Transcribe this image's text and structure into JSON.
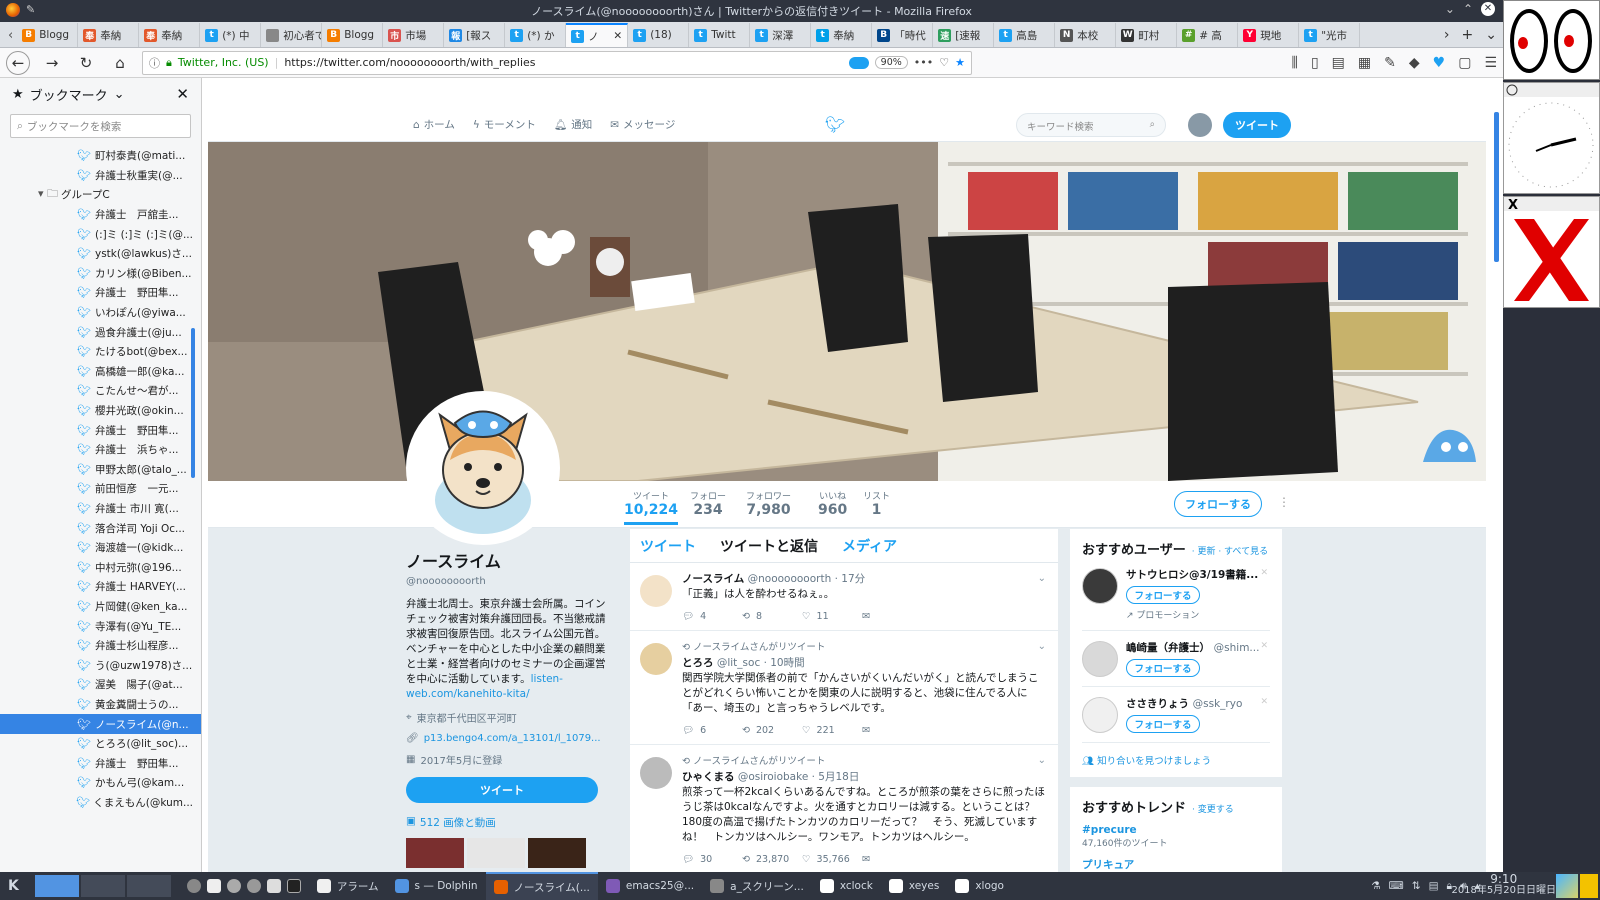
{
  "window": {
    "title": "ノースライム(@noooooooorth)さん | Twitterからの返信付きツイート - Mozilla Firefox"
  },
  "tabs": [
    {
      "label": "Blogg",
      "color": "#f57d00",
      "icon": "B"
    },
    {
      "label": "奉納",
      "color": "#e2582b",
      "icon": "奉"
    },
    {
      "label": "奉納",
      "color": "#e2582b",
      "icon": "奉"
    },
    {
      "label": "(*) 中",
      "color": "#1da1f2",
      "icon": "t"
    },
    {
      "label": "初心者で",
      "color": "#888888",
      "icon": ""
    },
    {
      "label": "Blogg",
      "color": "#f57d00",
      "icon": "B"
    },
    {
      "label": "市場",
      "color": "#d9534f",
      "icon": "市"
    },
    {
      "label": "[報ス",
      "color": "#1e88e5",
      "icon": "報"
    },
    {
      "label": "(*) か",
      "color": "#1da1f2",
      "icon": "t"
    },
    {
      "label": "ノ",
      "color": "#1da1f2",
      "icon": "t"
    },
    {
      "label": "(18)",
      "color": "#1da1f2",
      "icon": "t"
    },
    {
      "label": "Twitt",
      "color": "#1da1f2",
      "icon": "t"
    },
    {
      "label": "深澤",
      "color": "#1da1f2",
      "icon": "t"
    },
    {
      "label": "奉納",
      "color": "#00a0e9",
      "icon": "t"
    },
    {
      "label": "「時代",
      "color": "#00468b",
      "icon": "B"
    },
    {
      "label": "[速報",
      "color": "#2e9e5e",
      "icon": "速"
    },
    {
      "label": "高島",
      "color": "#1da1f2",
      "icon": "t"
    },
    {
      "label": "本校",
      "color": "#555555",
      "icon": "N"
    },
    {
      "label": "町村",
      "color": "#333333",
      "icon": "W"
    },
    {
      "label": "# 高",
      "color": "#5aa02c",
      "icon": "#"
    },
    {
      "label": "現地",
      "color": "#ff0033",
      "icon": "Y"
    },
    {
      "label": "\"光市",
      "color": "#1da1f2",
      "icon": "t"
    }
  ],
  "active_tab_index": 9,
  "navbar": {
    "identity": "Twitter, Inc. (US)",
    "url": "https://twitter.com/noooooooorth/with_replies",
    "zoom": "90%"
  },
  "sidebar": {
    "title": "ブックマーク",
    "search_placeholder": "ブックマークを検索",
    "items": [
      {
        "label": "町村泰貴(@mati...",
        "type": "bookmark"
      },
      {
        "label": "弁護士秋重実(@...",
        "type": "bookmark"
      },
      {
        "label": "グループC",
        "type": "folder"
      },
      {
        "label": "弁護士　戸舘圭...",
        "type": "bookmark"
      },
      {
        "label": "(:]ミ (:]ミ (:]ミ(@...",
        "type": "bookmark"
      },
      {
        "label": "ystk(@lawkus)さ...",
        "type": "bookmark"
      },
      {
        "label": "カリン様(@Biben...",
        "type": "bookmark"
      },
      {
        "label": "弁護士　野田隼...",
        "type": "bookmark"
      },
      {
        "label": "いわぽん(@yiwa...",
        "type": "bookmark"
      },
      {
        "label": "過食弁護士(@ju...",
        "type": "bookmark"
      },
      {
        "label": "たけるbot(@bex...",
        "type": "bookmark"
      },
      {
        "label": "高橋雄一郎(@ka...",
        "type": "bookmark"
      },
      {
        "label": "こたんせ〜君が...",
        "type": "bookmark"
      },
      {
        "label": "櫻井光政(@okin...",
        "type": "bookmark"
      },
      {
        "label": "弁護士　野田隼...",
        "type": "bookmark"
      },
      {
        "label": "弁護士　浜ちゃ...",
        "type": "bookmark"
      },
      {
        "label": "甲野太郎(@talo_...",
        "type": "bookmark"
      },
      {
        "label": "前田恒彦　一元...",
        "type": "bookmark"
      },
      {
        "label": "弁護士 市川 寛(...",
        "type": "bookmark"
      },
      {
        "label": "落合洋司 Yoji Oc...",
        "type": "bookmark"
      },
      {
        "label": "海渡雄一(@kidk...",
        "type": "bookmark"
      },
      {
        "label": "中村元弥(@196...",
        "type": "bookmark"
      },
      {
        "label": "弁護士 HARVEY(...",
        "type": "bookmark"
      },
      {
        "label": "片岡健(@ken_ka...",
        "type": "bookmark"
      },
      {
        "label": "寺澤有(@Yu_TE...",
        "type": "bookmark"
      },
      {
        "label": "弁護士杉山程彦...",
        "type": "bookmark"
      },
      {
        "label": "う(@uzw1978)さ...",
        "type": "bookmark"
      },
      {
        "label": "渥美　陽子(@at...",
        "type": "bookmark"
      },
      {
        "label": "黄金糞闘士うの...",
        "type": "bookmark"
      },
      {
        "label": "ノースライム(@n...",
        "type": "bookmark",
        "selected": true
      },
      {
        "label": "とろろ(@lit_soc)...",
        "type": "bookmark"
      },
      {
        "label": "弁護士　野田隼...",
        "type": "bookmark"
      },
      {
        "label": "かもん弓(@kam...",
        "type": "bookmark"
      },
      {
        "label": "くまえもん(@kum...",
        "type": "bookmark"
      }
    ]
  },
  "twitter": {
    "nav": {
      "home": "ホーム",
      "moments": "モーメント",
      "notifications": "通知",
      "messages": "メッセージ",
      "search_placeholder": "キーワード検索",
      "tweet_button": "ツイート"
    },
    "stats": [
      {
        "label": "ツイート",
        "value": "10,224"
      },
      {
        "label": "フォロー",
        "value": "234"
      },
      {
        "label": "フォロワー",
        "value": "7,980"
      },
      {
        "label": "いいね",
        "value": "960"
      },
      {
        "label": "リスト",
        "value": "1"
      }
    ],
    "follow_button": "フォローする",
    "profile": {
      "name": "ノースライム",
      "handle": "@noooooooorth",
      "bio": "弁護士北周士。東京弁護士会所属。コインチェック被害対策弁護団団長。不当懲戒請求被害回復原告団。北スライム公国元首。ベンチャーを中心とした中小企業の顧問業と士業・経営者向けのセミナーの企画運営を中心に活動しています。",
      "bio_link": "listen-web.com/kanehito-kita/",
      "location": "東京都千代田区平河町",
      "website": "p13.bengo4.com/a_13101/l_1079...",
      "joined": "2017年5月に登録",
      "tweet_button": "ツイート",
      "media_link": "512 画像と動画"
    },
    "timeline_tabs": [
      "ツイート",
      "ツイートと返信",
      "メディア"
    ],
    "tweets": [
      {
        "retweeted_by": "",
        "name": "ノースライム",
        "handle": "@noooooooorth",
        "time": "· 17分",
        "text": "「正義」は人を酔わせるねぇ。。",
        "replies": "4",
        "retweets": "8",
        "likes": "11"
      },
      {
        "retweeted_by": "ノースライムさんがリツイート",
        "name": "とろろ",
        "handle": "@lit_soc",
        "time": "· 10時間",
        "text": "関西学院大学関係者の前で「かんさいがくいんだいがく」と読んでしまうことがどれくらい怖いことかを関東の人に説明すると、池袋に住んでる人に「あー、埼玉の」と言っちゃうレベルです。",
        "replies": "6",
        "retweets": "202",
        "likes": "221"
      },
      {
        "retweeted_by": "ノースライムさんがリツイート",
        "name": "ひゃくまる",
        "handle": "@osiroiobake",
        "time": "· 5月18日",
        "text": "煎茶って一杯2kcalくらいあるんですね。ところが煎茶の葉をさらに煎ったほうじ茶は0kcalなんですよ。火を通すとカロリーは減する。ということは？180度の高温で揚げたトンカツのカロリーだって？　そう、死滅しています ね！　トンカツはヘルシー。ワンモア。トンカツはヘルシー。",
        "replies": "30",
        "retweets": "23,870",
        "likes": "35,766"
      }
    ],
    "wtf": {
      "title": "おすすめユーザー",
      "refresh": "· 更新 · すべて見る",
      "users": [
        {
          "name": "サトウヒロシ@3/19書籍...",
          "handle": "",
          "follow": "フォローする",
          "promo": "プロモーション"
        },
        {
          "name": "嶋崎量（弁護士）",
          "handle": "@shim...",
          "follow": "フォローする",
          "promo": ""
        },
        {
          "name": "ささきりょう",
          "handle": "@ssk_ryo",
          "follow": "フォローする",
          "promo": ""
        }
      ],
      "find_friends": "知り合いを見つけましょう"
    },
    "trends": {
      "title": "おすすめトレンド",
      "change": "· 変更する",
      "items": [
        {
          "tag": "#precure",
          "count": "47,160件のツイート"
        },
        {
          "tag": "プリキュア",
          "count": ""
        }
      ]
    }
  },
  "taskbar": {
    "items": [
      {
        "label": "アラーム",
        "color": "#f0f0f0"
      },
      {
        "label": "s — Dolphin",
        "color": "#5294e2"
      },
      {
        "label": "ノースライム(...",
        "color": "#e66000",
        "active": true
      },
      {
        "label": "emacs25@...",
        "color": "#7f5ab6"
      },
      {
        "label": "a_スクリーン...",
        "color": "#888888"
      },
      {
        "label": "xclock",
        "color": "#ffffff"
      },
      {
        "label": "xeyes",
        "color": "#ffffff"
      },
      {
        "label": "xlogo",
        "color": "#ffffff"
      }
    ],
    "time": "9:10",
    "date": "2018年5月20日日曜日"
  }
}
